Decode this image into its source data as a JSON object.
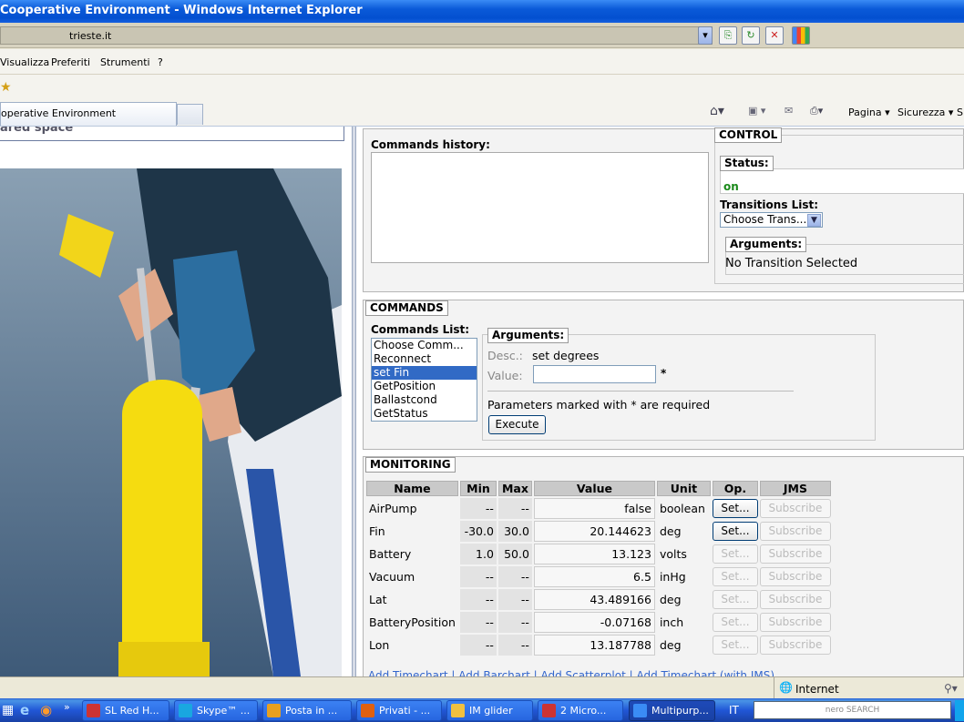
{
  "window": {
    "title": "Cooperative Environment - Windows Internet Explorer"
  },
  "address": {
    "url": "trieste.it"
  },
  "menu": [
    "Visualizza",
    "Preferiti",
    "Strumenti",
    "?"
  ],
  "tab": {
    "label": "operative Environment"
  },
  "commandbar": {
    "page": "Pagina",
    "security": "Sicurezza",
    "more": "S"
  },
  "left": {
    "header": "ared space"
  },
  "history": {
    "label": "Commands history:"
  },
  "control": {
    "legend": "CONTROL",
    "status_legend": "Status:",
    "status_value": "on",
    "transitions_label": "Transitions List:",
    "transitions_selected": "Choose Trans...",
    "arguments_legend": "Arguments:",
    "arguments_text": "No Transition Selected"
  },
  "commands": {
    "legend": "COMMANDS",
    "list_label": "Commands List:",
    "items": [
      "Choose Comm...",
      "Reconnect",
      "set Fin",
      "GetPosition",
      "Ballastcond",
      "GetStatus"
    ],
    "selected_index": 2,
    "arguments_legend": "Arguments:",
    "desc_label": "Desc.:",
    "desc_value": "set degrees",
    "value_label": "Value:",
    "value_input": "",
    "required_mark": "*",
    "required_note": "Parameters marked with * are required",
    "execute_label": "Execute"
  },
  "monitoring": {
    "legend": "MONITORING",
    "columns": [
      "Name",
      "Min",
      "Max",
      "Value",
      "Unit",
      "Op.",
      "JMS"
    ],
    "rows": [
      {
        "name": "AirPump",
        "min": "--",
        "max": "--",
        "value": "false",
        "unit": "boolean",
        "op": "Set...",
        "op_enabled": true,
        "jms": "Subscribe"
      },
      {
        "name": "Fin",
        "min": "-30.0",
        "max": "30.0",
        "value": "20.144623",
        "unit": "deg",
        "op": "Set...",
        "op_enabled": true,
        "jms": "Subscribe"
      },
      {
        "name": "Battery",
        "min": "1.0",
        "max": "50.0",
        "value": "13.123",
        "unit": "volts",
        "op": "Set...",
        "op_enabled": false,
        "jms": "Subscribe"
      },
      {
        "name": "Vacuum",
        "min": "--",
        "max": "--",
        "value": "6.5",
        "unit": "inHg",
        "op": "Set...",
        "op_enabled": false,
        "jms": "Subscribe"
      },
      {
        "name": "Lat",
        "min": "--",
        "max": "--",
        "value": "43.489166",
        "unit": "deg",
        "op": "Set...",
        "op_enabled": false,
        "jms": "Subscribe"
      },
      {
        "name": "BatteryPosition",
        "min": "--",
        "max": "--",
        "value": "-0.07168",
        "unit": "inch",
        "op": "Set...",
        "op_enabled": false,
        "jms": "Subscribe"
      },
      {
        "name": "Lon",
        "min": "--",
        "max": "--",
        "value": "13.187788",
        "unit": "deg",
        "op": "Set...",
        "op_enabled": false,
        "jms": "Subscribe"
      }
    ],
    "footer_links": "Add Timechart | Add Barchart | Add Scatterplot | Add Timechart (with JMS)"
  },
  "statusbar": {
    "zone": "Internet"
  },
  "taskbar": {
    "items": [
      {
        "label": "SL Red H...",
        "color": "#c33"
      },
      {
        "label": "Skype™ ...",
        "color": "#19a7e0"
      },
      {
        "label": "Posta in ...",
        "color": "#e8a020"
      },
      {
        "label": "Privati - ...",
        "color": "#e06010"
      },
      {
        "label": "IM glider",
        "color": "#f0c040"
      },
      {
        "label": "2 Micro...",
        "color": "#c33"
      },
      {
        "label": "Multipurp...",
        "color": "#3a8cf5"
      }
    ],
    "lang": "IT",
    "search": "nero SEARCH"
  }
}
